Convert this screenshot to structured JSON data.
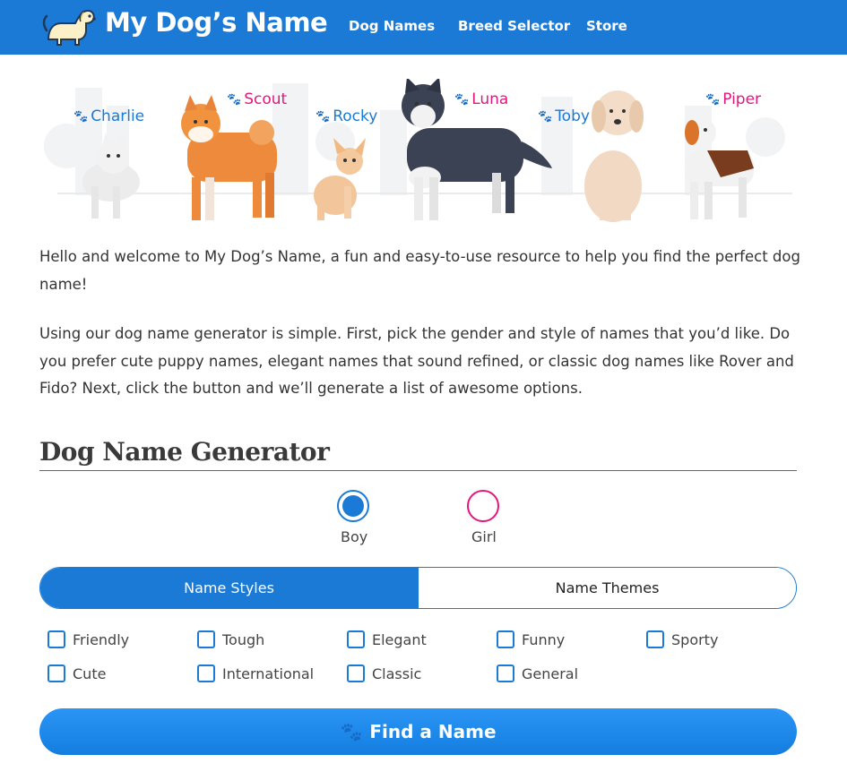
{
  "header": {
    "site_title": "My Dog’s Name",
    "nav": [
      "Dog Names",
      "Breed Selector",
      "Store"
    ]
  },
  "banner": {
    "dogs": [
      {
        "name": "Charlie",
        "color": "blue"
      },
      {
        "name": "Scout",
        "color": "pink"
      },
      {
        "name": "Rocky",
        "color": "blue"
      },
      {
        "name": "Luna",
        "color": "pink"
      },
      {
        "name": "Toby",
        "color": "blue"
      },
      {
        "name": "Piper",
        "color": "pink"
      }
    ]
  },
  "intro": {
    "p1": "Hello and welcome to My Dog’s Name, a fun and easy-to-use resource to help you find the perfect dog name!",
    "p2": "Using our dog name generator is simple. First, pick the gender and style of names that you’d like. Do you prefer cute puppy names, elegant names that sound refined, or classic dog names like Rover and Fido? Next, click the button and we’ll generate a list of awesome options."
  },
  "generator": {
    "title": "Dog Name Generator",
    "gender": {
      "boy": "Boy",
      "girl": "Girl",
      "selected": "Boy"
    },
    "tabs": {
      "styles": "Name Styles",
      "themes": "Name Themes",
      "active": "Name Styles"
    },
    "styles": [
      "Friendly",
      "Tough",
      "Elegant",
      "Funny",
      "Sporty",
      "Cute",
      "International",
      "Classic",
      "General"
    ],
    "find_button": "Find a Name"
  },
  "colors": {
    "brand_blue": "#1a7ad6",
    "girl_pink": "#e2177f"
  },
  "icons": [
    "dog-logo-icon",
    "paw-icon"
  ]
}
